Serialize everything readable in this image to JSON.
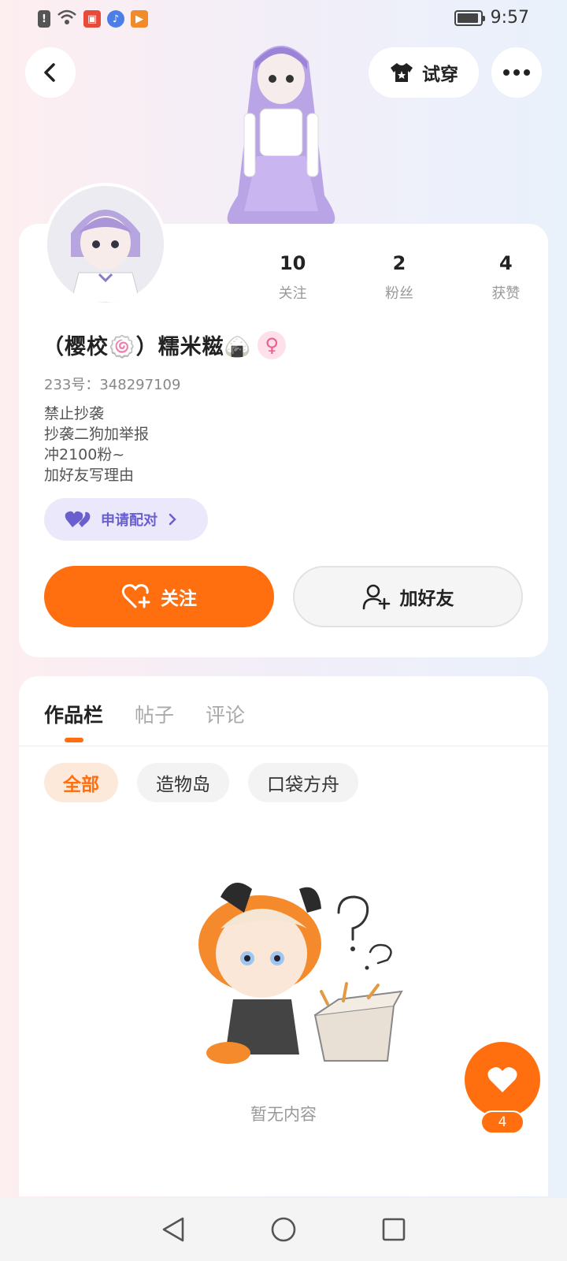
{
  "status_bar": {
    "time": "9:57",
    "app_icons": [
      "alert-icon",
      "wifi-icon",
      "video-app-icon",
      "music-app-icon",
      "player-app-icon"
    ]
  },
  "header": {
    "try_on_label": "试穿"
  },
  "profile": {
    "name": "（樱校🍥）糯米糍🍙",
    "gender_symbol": "♀",
    "uid": "233号：348297109",
    "bio": [
      "禁止抄袭",
      "抄袭二狗加举报",
      "冲2100粉~",
      "加好友写理由"
    ],
    "stats": [
      {
        "value": "10",
        "label": "关注"
      },
      {
        "value": "2",
        "label": "粉丝"
      },
      {
        "value": "4",
        "label": "获赞"
      }
    ],
    "pair_label": "申请配对",
    "follow_label": "关注",
    "add_friend_label": "加好友"
  },
  "works": {
    "tabs": [
      "作品栏",
      "帖子",
      "评论"
    ],
    "active_tab": 0,
    "chips": [
      "全部",
      "造物岛",
      "口袋方舟"
    ],
    "active_chip": 0,
    "empty_text": "暂无内容"
  },
  "like_fab": {
    "count": "4"
  },
  "colors": {
    "accent": "#ff6f0f",
    "pair_bg": "#ebe8fb",
    "pair_text": "#6a5fcf",
    "gender_pink": "#ea5d8d"
  }
}
